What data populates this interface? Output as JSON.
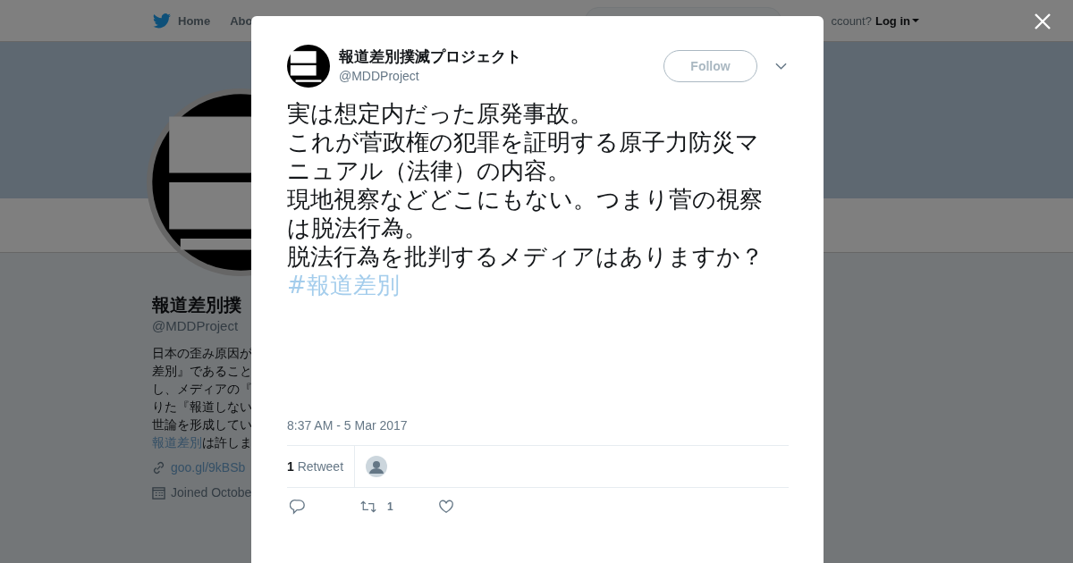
{
  "nav": {
    "items": [
      "Home",
      "Abo"
    ],
    "account_prompt": "ccount?",
    "login": "Log in"
  },
  "profile": {
    "name": "報道差別撲",
    "handle": "@MDDProject",
    "bio_lines": [
      {
        "text": "日本の歪み原因が"
      },
      {
        "text": "差別』であること"
      },
      {
        "text": "し、メディアの『"
      },
      {
        "text": "りた『報道しない"
      },
      {
        "text": "世論を形成してい"
      },
      {
        "link": "報道差別",
        "text": "は許しま"
      }
    ],
    "url": "goo.gl/9kBSb",
    "joined": "Joined Octobe"
  },
  "tweet": {
    "author": "報道差別撲滅プロジェクト",
    "handle": "@MDDProject",
    "follow": "Follow",
    "lines": [
      "実は想定内だった原発事故。",
      "これが菅政権の犯罪を証明する原子力防災マ",
      "ニュアル（法律）の内容。",
      "現地視察などどこにもない。つまり菅の視察",
      "は脱法行為。",
      "脱法行為を批判するメディアはありますか？"
    ],
    "hashtag": "#報道差別",
    "time": "8:37 AM - 5 Mar 2017",
    "retweet_count": "1",
    "retweet_label": "Retweet",
    "action_retweets": "1"
  }
}
